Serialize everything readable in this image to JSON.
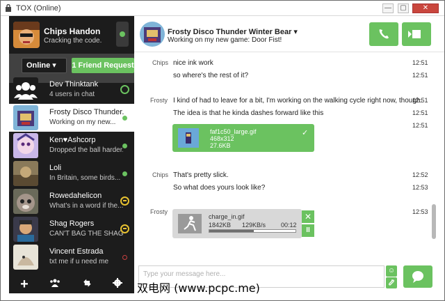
{
  "window": {
    "title": "TOX (Online)",
    "minimize": "—",
    "maximize": "▢",
    "close": "✕"
  },
  "me": {
    "name": "Chips Handon",
    "status_message": "Cracking the code.",
    "status_color": "#6bc260"
  },
  "filters": {
    "online_label": "Online ▾",
    "friend_request_label": "1 Friend Request"
  },
  "contacts": [
    {
      "name": "Dev Thinktank",
      "status": "4 users in chat",
      "indicator": "group"
    },
    {
      "name": "Frosty Disco Thunder...",
      "status": "Working on my new...",
      "indicator": "online"
    },
    {
      "name": "Ken♥Ashcorp",
      "status": "Dropped the ball harder...",
      "indicator": "online"
    },
    {
      "name": "Loli",
      "status": "In Britain, some birds...",
      "indicator": "online"
    },
    {
      "name": "Rowedahelicon",
      "status": "What's in a word if the...",
      "indicator": "away"
    },
    {
      "name": "Shag Rogers",
      "status": "CAN'T BAG THE SHAG",
      "indicator": "busy"
    },
    {
      "name": "Vincent Estrada",
      "status": "txt me if u need me",
      "indicator": "offline"
    }
  ],
  "toolbar": {
    "add_icon": "+",
    "group_icon": "group-icon",
    "transfers_icon": "transfers-icon",
    "settings_icon": "gear-icon"
  },
  "chat": {
    "peer_name": "Frosty Disco Thunder Winter Bear ▾",
    "peer_status": "Working on my new game: Door Fist!",
    "messages": [
      {
        "author": "Chips",
        "text": "nice ink work",
        "time": "12:51"
      },
      {
        "author": "",
        "text": "so where's the rest of it?",
        "time": "12:51"
      },
      {
        "author": "Frosty",
        "text": "I kind of had to leave for a bit, I'm working on the walking cycle right now, though.",
        "time": "12:51"
      },
      {
        "author": "",
        "text": "The idea is that he kinda dashes forward like this",
        "time": "12:51"
      },
      {
        "author": "",
        "text": "",
        "time": "12:51"
      },
      {
        "author": "Chips",
        "text": "That's pretty slick.",
        "time": "12:52"
      },
      {
        "author": "",
        "text": "So what does yours look like?",
        "time": "12:53"
      },
      {
        "author": "Frosty",
        "text": "",
        "time": "12:53"
      }
    ],
    "file_done": {
      "name": "faf1c50_large.gif",
      "dims": "468x312",
      "size": "27.6KB",
      "check": "✓"
    },
    "file_transfer": {
      "name": "charge_in.gif",
      "size": "1842KB",
      "rate": "129KB/s",
      "time_left": "00:12",
      "progress": 0.52,
      "cancel": "✕",
      "pause": "II"
    }
  },
  "composer": {
    "placeholder": "Type your message here...",
    "emoji": "☺",
    "attach": "⚲"
  },
  "watermark": "双电网 (www.pcpc.me)",
  "colors": {
    "accent": "#6bc260",
    "sidebar": "#1c1c1c",
    "filter_bar": "#414141",
    "away": "#e8c231",
    "offline": "#c84040"
  }
}
